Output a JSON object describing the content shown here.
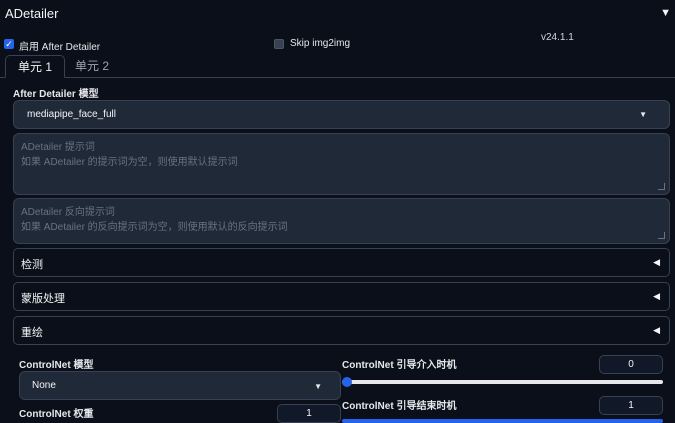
{
  "header": {
    "title": "ADetailer",
    "collapse_icon": "triangle-down"
  },
  "enable": {
    "label": "启用 After Detailer",
    "checked": true
  },
  "skip_img2img": {
    "label": "Skip img2img",
    "checked": false
  },
  "version": "v24.1.1",
  "tabs": [
    {
      "label": "单元 1",
      "active": true
    },
    {
      "label": "单元 2",
      "active": false
    }
  ],
  "model": {
    "label": "After Detailer 模型",
    "value": "mediapipe_face_full"
  },
  "prompt": {
    "label": "ADetailer 提示词",
    "placeholder": "如果 ADetailer 的提示词为空，则使用默认提示词"
  },
  "negative_prompt": {
    "label": "ADetailer 反向提示词",
    "placeholder": "如果 ADetailer 的反向提示词为空，则使用默认的反向提示词"
  },
  "accordions": [
    {
      "label": "检测"
    },
    {
      "label": "蒙版处理"
    },
    {
      "label": "重绘"
    }
  ],
  "controlnet": {
    "model_label": "ControlNet 模型",
    "model_value": "None",
    "weight_label": "ControlNet 权重",
    "weight_value": "1",
    "guidance_start_label": "ControlNet 引导介入时机",
    "guidance_start_value": "0",
    "guidance_start_fraction": 0,
    "guidance_end_label": "ControlNet 引导结束时机",
    "guidance_end_value": "1",
    "guidance_end_fraction": 1
  },
  "colors": {
    "accent": "#2563eb",
    "background": "#0b0f19",
    "panel": "#1f2937"
  }
}
